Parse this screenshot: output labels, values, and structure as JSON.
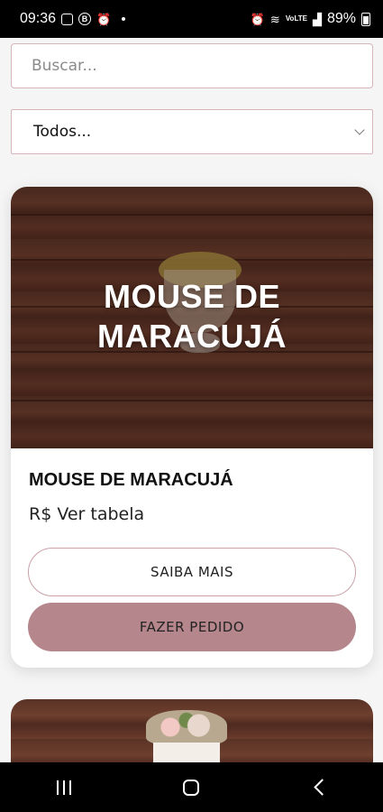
{
  "status_bar": {
    "time": "09:36",
    "network": "VoLTE",
    "battery": "89%"
  },
  "search": {
    "placeholder": "Buscar...",
    "value": ""
  },
  "filter": {
    "selected": "Todos..."
  },
  "products": [
    {
      "image_title": "MOUSE DE MARACUJÁ",
      "title": "MOUSE DE MARACUJÁ",
      "price": "R$ Ver tabela",
      "more_label": "SAIBA MAIS",
      "order_label": "FAZER PEDIDO"
    }
  ],
  "colors": {
    "accent": "#b5868c",
    "border": "#d8b4bb",
    "outline_button": "#c9a1a7"
  },
  "icons": {
    "nav_recents": "recents-icon",
    "nav_home": "home-icon",
    "nav_back": "back-icon"
  }
}
